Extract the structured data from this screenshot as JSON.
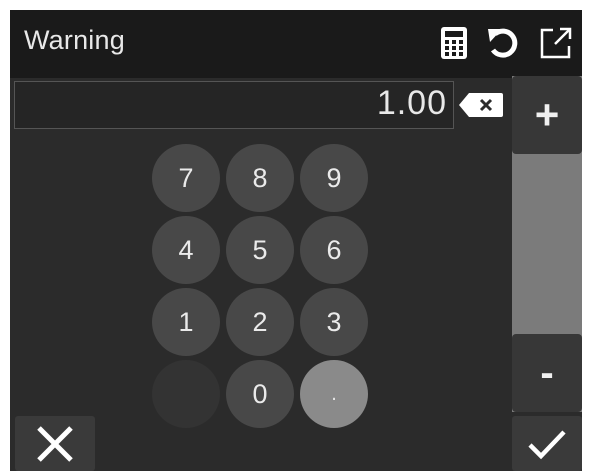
{
  "header": {
    "title": "Warning",
    "icons": [
      "calculator-icon",
      "undo-icon",
      "external-link-icon"
    ]
  },
  "display": {
    "value": "1.00",
    "backspace_icon": "backspace-icon"
  },
  "stepper": {
    "plus_label": "+",
    "minus_label": "-"
  },
  "keypad": {
    "keys": [
      "7",
      "8",
      "9",
      "4",
      "5",
      "6",
      "1",
      "2",
      "3",
      "",
      "0",
      "."
    ]
  },
  "actions": {
    "cancel_icon": "close-icon",
    "confirm_icon": "checkmark-icon"
  },
  "colors": {
    "background": "#2b2b2b",
    "header": "#1a1a1a",
    "key": "#484848",
    "key_highlight": "#8a8a8a",
    "text": "#e8e8e8"
  }
}
